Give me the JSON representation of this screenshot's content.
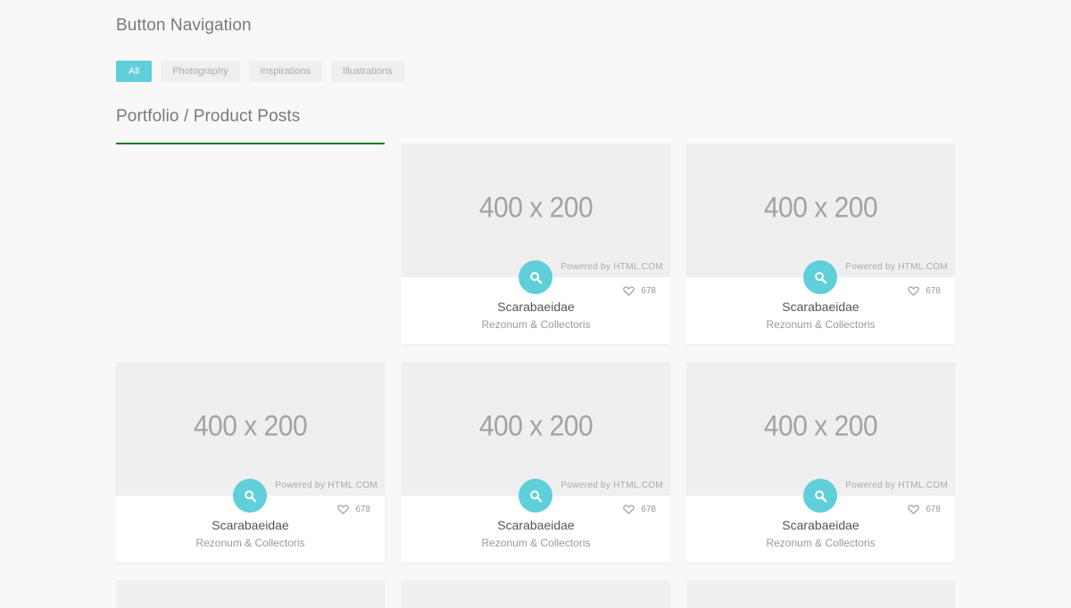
{
  "nav_section": {
    "title": "Button Navigation",
    "filters": [
      "All",
      "Photography",
      "Inspirations",
      "Illustrations"
    ],
    "active_filter": "All"
  },
  "portfolio": {
    "title": "Portfolio / Product Posts",
    "cards": [
      {
        "thumb_text": "400 x 200",
        "powered": "Powered by HTML.COM",
        "likes": "678",
        "title": "Scarabaeidae",
        "subtitle": "Rezonum & Collectoris"
      },
      {
        "thumb_text": "400 x 200",
        "powered": "Powered by HTML.COM",
        "likes": "678",
        "title": "Scarabaeidae",
        "subtitle": "Rezonum & Collectoris"
      },
      {
        "thumb_text": "400 x 200",
        "powered": "Powered by HTML.COM",
        "likes": "678",
        "title": "Scarabaeidae",
        "subtitle": "Rezonum & Collectoris"
      },
      {
        "thumb_text": "400 x 200",
        "powered": "Powered by HTML.COM",
        "likes": "678",
        "title": "Scarabaeidae",
        "subtitle": "Rezonum & Collectoris"
      },
      {
        "thumb_text": "400 x 200",
        "powered": "Powered by HTML.COM",
        "likes": "678",
        "title": "Scarabaeidae",
        "subtitle": "Rezonum & Collectoris"
      }
    ]
  },
  "icons": {
    "zoom": "search-icon",
    "like": "heart-icon"
  },
  "colors": {
    "accent": "#5fcfd9",
    "underline": "#1e7d1e",
    "background": "#f8f8f8",
    "thumb": "#efefef"
  }
}
